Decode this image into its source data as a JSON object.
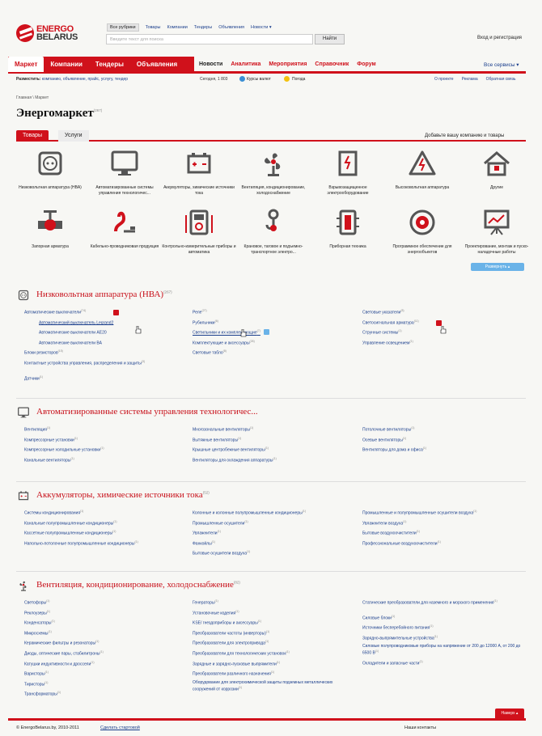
{
  "header": {
    "logo_top": "ENERGO",
    "logo_bottom": "BELARUS",
    "search_tabs": [
      "Все рубрики",
      "Товары",
      "Компании",
      "Тендеры",
      "Объявления",
      "Новости ▾"
    ],
    "search_placeholder": "Введите текст для поиска",
    "search_button": "Найти",
    "login": "Вход и регистрация"
  },
  "nav": {
    "red": [
      "Маркет",
      "Компании",
      "Тендеры",
      "Объявления"
    ],
    "white": [
      "Новости",
      "Аналитика",
      "Мероприятия",
      "Справочник",
      "Форум"
    ],
    "all": "Все сервисы ▾"
  },
  "subnav": {
    "place_label": "Разместить:",
    "place_items": [
      "компанию,",
      "объявление,",
      "прайс,",
      "услугу,",
      "тендер"
    ],
    "date": "Сегодня, 1 803",
    "rates": "Курсы валют",
    "weather": "Погода",
    "right": [
      "О проекте",
      "Реклама",
      "Обратная связь"
    ]
  },
  "breadcrumb": "Главная \\ Маркет",
  "page_title": "Энергомаркет",
  "page_count": "(267)",
  "tabs": [
    "Товары",
    "Услуги"
  ],
  "add_company": "Добавьте вашу компанию и товары",
  "categories": [
    {
      "label": "Низковольтная аппаратура (НВА)",
      "icon": "socket-icon"
    },
    {
      "label": "Автоматизированные системы управления технологичес...",
      "icon": "monitor-icon"
    },
    {
      "label": "Аккумуляторы, химические источники тока",
      "icon": "battery-icon"
    },
    {
      "label": "Вентиляция, кондиционирование, холодоснабжение",
      "icon": "fan-icon"
    },
    {
      "label": "Взрывозащищенное электрооборудование",
      "icon": "explosion-box-icon"
    },
    {
      "label": "Высоковольтная аппаратура",
      "icon": "high-voltage-icon"
    },
    {
      "label": "Другие",
      "icon": "house-icon"
    },
    {
      "label": "Запорная арматура",
      "icon": "valve-icon"
    },
    {
      "label": "Кабельно-проводниковая продукция",
      "icon": "cable-icon"
    },
    {
      "label": "Контрольно-измерительные приборы и автоматика",
      "icon": "multimeter-icon"
    },
    {
      "label": "Крановое, таговое и подъемно-транспортное электро...",
      "icon": "crane-hook-icon"
    },
    {
      "label": "Приборная техника",
      "icon": "device-icon"
    },
    {
      "label": "Программное обеспечение для энергообъектов",
      "icon": "disc-icon"
    },
    {
      "label": "Проектирование, монтаж и пуско-наладочные работы",
      "icon": "chart-board-icon"
    }
  ],
  "expand_button": "Развернуть ▴",
  "sections": [
    {
      "title": "Низковольтная аппаратура (НВА)",
      "count": "(267)",
      "icon": "socket-icon",
      "col1": [
        [
          "Автоматические выключатели",
          "(74)"
        ],
        [
          "Автоматический выключатель Legrand2",
          ""
        ],
        [
          "Автоматические выключатели АЕ20",
          ""
        ],
        [
          "Автоматические выключатели ВА",
          ""
        ],
        [
          "Блоки резисторов",
          "(15)"
        ],
        [
          "Контактные устройства управления, распределения и защиты",
          "(3)"
        ],
        [
          "Датчики",
          "(1)"
        ]
      ],
      "col2": [
        [
          "Реле",
          "(27)"
        ],
        [
          "Рубильники",
          "(6)"
        ],
        [
          "Светильники и их комплектующие",
          "(7)"
        ],
        [
          "Комплектующие и аксессуары",
          "(26)"
        ],
        [
          "Световые табло",
          "(8)"
        ]
      ],
      "col3": [
        [
          "Световые указатели",
          "(8)"
        ],
        [
          "Светосигнальная арматура",
          "(11)"
        ],
        [
          "Струнные системы",
          "(1)"
        ],
        [
          "Управление освещением",
          "(1)"
        ]
      ]
    },
    {
      "title": "Автоматизированные системы управления технологичес...",
      "count": "",
      "icon": "monitor-icon",
      "col1": [
        [
          "Вентиляция",
          "(1)"
        ],
        [
          "Компрессорные установки",
          "(1)"
        ],
        [
          "Компрессорные холодильные установки",
          "(1)"
        ],
        [
          "Канальные вентиляторы",
          "(1)"
        ]
      ],
      "col2": [
        [
          "Многозональные вентиляторы",
          "(1)"
        ],
        [
          "Вытяжные вентиляторы",
          "(1)"
        ],
        [
          "Крышные центробежные вентиляторы",
          "(1)"
        ],
        [
          "Вентиляторы для охлаждения аппаратуры",
          "(1)"
        ]
      ],
      "col3": [
        [
          "Потолочные вентиляторы",
          "(1)"
        ],
        [
          "Осевые вентиляторы",
          "(1)"
        ],
        [
          "Вентиляторы для дома и офиса",
          "(1)"
        ]
      ]
    },
    {
      "title": "Аккумуляторы, химические источники тока",
      "count": "(52)",
      "icon": "battery-icon",
      "col1": [
        [
          "Системы кондиционирования",
          "(1)"
        ],
        [
          "Канальные полупромышленные кондиционеры",
          "(1)"
        ],
        [
          "Кассетные полупромышленные кондиционеры",
          "(1)"
        ],
        [
          "Напольно-потолочные полупромышленные кондиционеры",
          "(1)"
        ]
      ],
      "col2": [
        [
          "Колонные и колонные полупромышленные кондиционеры",
          "(1)"
        ],
        [
          "Промышленные осушители",
          "(1)"
        ],
        [
          "Увлажнители",
          "(1)"
        ],
        [
          "Фанкойлы",
          "(1)"
        ],
        [
          "Бытовые осушители воздуха",
          "(1)"
        ]
      ],
      "col3": [
        [
          "Промышленные и полупромышленные осушители воздуха",
          "(1)"
        ],
        [
          "Увлажнители воздуха",
          "(1)"
        ],
        [
          "Бытовые воздухоочистители",
          "(1)"
        ],
        [
          "Профессиональные воздухоочистители",
          "(1)"
        ]
      ]
    },
    {
      "title": "Вентиляция, кондиционирование, холодоснабжение",
      "count": "(82)",
      "icon": "fan-icon",
      "col1": [
        [
          "Светофоры",
          "(1)"
        ],
        [
          "Реклоузеры",
          "(1)"
        ],
        [
          "Конденсаторы",
          "(1)"
        ],
        [
          "Микросхемы",
          "(1)"
        ],
        [
          "Керамические фильтры и резонаторы",
          "(1)"
        ],
        [
          "Диоды, оптические пары, стабилитроны",
          "(1)"
        ],
        [
          "Катушки индуктивности и дроссели",
          "(1)"
        ],
        [
          "Варисторы",
          "(1)"
        ],
        [
          "Тиристоры",
          "(1)"
        ],
        [
          "Трансформаторы",
          "(1)"
        ]
      ],
      "col2": [
        [
          "Генераторы",
          "(1)"
        ],
        [
          "Установочные изделия",
          "(1)"
        ],
        [
          "KSE/ гнездоприборы и аксессуары",
          "(1)"
        ],
        [
          "Преобразователи частоты (инверторы)",
          "(1)"
        ],
        [
          "Преобразователи для электропривода",
          "(1)"
        ],
        [
          "Преобразователи для технологических установок",
          "(1)"
        ],
        [
          "Зарядные и зарядно-пусковые выпрямители",
          "(1)"
        ],
        [
          "Преобразователи различного назначения",
          "(1)"
        ],
        [
          "Оборудование для электрохимической защиты подземных металлических сооружений от коррозии",
          "(1)"
        ]
      ],
      "col3": [
        [
          "Статические преобразователи для наземного и морского применения",
          "(1)"
        ],
        [
          "Силовые блоки",
          "(1)"
        ],
        [
          "Источники бесперебойного питания",
          "(1)"
        ],
        [
          "Зарядно-выпрямительные устройства",
          "(1)"
        ],
        [
          "Силовые полупроводниковые приборы на напряжение от 200 до 12000 А, от 200 до 6500 В",
          "(1)"
        ],
        [
          "Охладители и запасные части",
          "(1)"
        ]
      ]
    }
  ],
  "footer": {
    "back_top": "Наверх ▴",
    "copyright": "© EnergoBelarus.by, 2010-2011",
    "start_page": "Сделать стартовой",
    "contacts": "Наши контакты"
  }
}
